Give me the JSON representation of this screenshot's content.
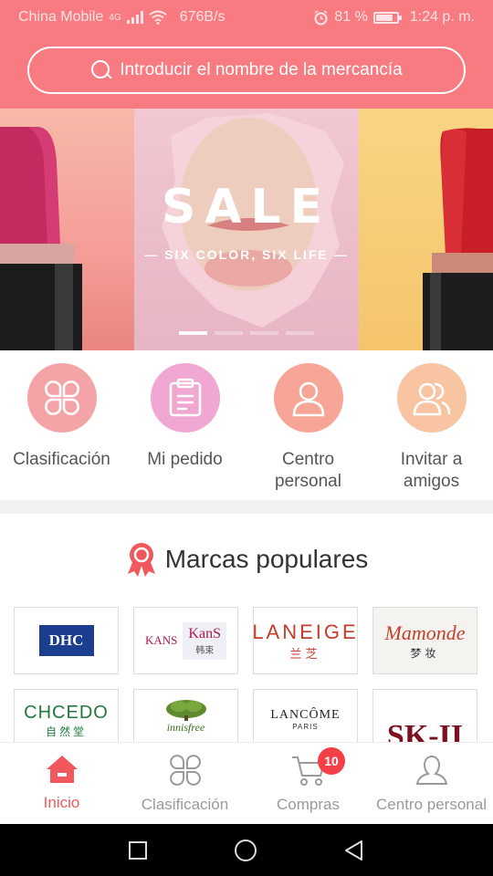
{
  "status_bar": {
    "carrier": "China Mobile",
    "network_type": "4G",
    "speed": "676B/s",
    "battery": "81 %",
    "battery_level": 0.81,
    "time": "1:24 p. m."
  },
  "search": {
    "placeholder": "Introducir el nombre de la mercancía"
  },
  "banner": {
    "title": "SALE",
    "subtitle": "— SIX COLOR, SIX LIFE —",
    "slides": 4,
    "active_slide": 1
  },
  "quick_menu": [
    {
      "label": "Clasificación",
      "icon": "grid-icon",
      "color": "#f4a3a7"
    },
    {
      "label": "Mi pedido",
      "icon": "clipboard-icon",
      "color": "#f0a7d1"
    },
    {
      "label": "Centro personal",
      "icon": "person-icon",
      "color": "#f7a596"
    },
    {
      "label": "Invitar a amigos",
      "icon": "people-icon",
      "color": "#f8c4a2"
    }
  ],
  "brands": {
    "title": "Marcas populares",
    "items": [
      {
        "name": "DHC"
      },
      {
        "name": "KANS",
        "name2": "KanS",
        "sub": "韩束"
      },
      {
        "name": "LANEIGE",
        "sub": "兰芝"
      },
      {
        "name": "Mamonde",
        "sub": "梦妆"
      },
      {
        "name": "CHCEDO",
        "sub": "自然堂"
      },
      {
        "name": "innisfree"
      },
      {
        "name": "LANCÔME",
        "sub": "PARIS"
      },
      {
        "name": "SK-II"
      }
    ]
  },
  "bottom_nav": [
    {
      "label": "Inicio",
      "icon": "home-icon",
      "active": true
    },
    {
      "label": "Clasificación",
      "icon": "grid-icon",
      "active": false
    },
    {
      "label": "Compras",
      "icon": "cart-icon",
      "active": false,
      "badge": "10"
    },
    {
      "label": "Centro personal",
      "icon": "person-icon",
      "active": false
    }
  ],
  "colors": {
    "brand": "#f87b82",
    "accent": "#f1585e",
    "badge": "#f24046"
  }
}
